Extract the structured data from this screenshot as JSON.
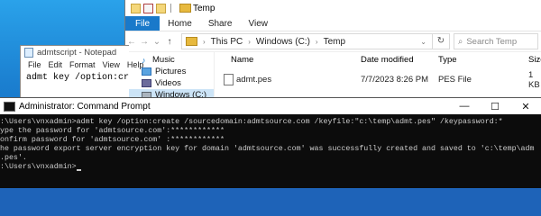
{
  "explorer": {
    "title": "Temp",
    "ribbon_tabs": [
      "File",
      "Home",
      "Share",
      "View"
    ],
    "breadcrumb": [
      "This PC",
      "Windows (C:)",
      "Temp"
    ],
    "search_placeholder": "Search Temp",
    "nav_items": [
      {
        "label": "Music",
        "icon": "music-icon"
      },
      {
        "label": "Pictures",
        "icon": "pictures-icon"
      },
      {
        "label": "Videos",
        "icon": "videos-icon"
      },
      {
        "label": "Windows (C:)",
        "icon": "drive-icon"
      }
    ],
    "columns": [
      "Name",
      "Date modified",
      "Type",
      "Size"
    ],
    "files": [
      {
        "name": "admt.pes",
        "date": "7/7/2023 8:26 PM",
        "type": "PES File",
        "size": "1 KB"
      }
    ]
  },
  "notepad": {
    "title": "admtscript - Notepad",
    "menu": [
      "File",
      "Edit",
      "Format",
      "View",
      "Help"
    ],
    "content": "admt key /option:create"
  },
  "cmd": {
    "title": "Administrator: Command Prompt",
    "controls": [
      "—",
      "☐",
      "✕"
    ],
    "lines": [
      ":\\Users\\vnxadmin>admt key /option:create /sourcedomain:admtsource.com /keyfile:\"c:\\temp\\admt.pes\" /keypassword:*",
      "ype the password for 'admtsource.com':************",
      "onfirm password for 'admtsource.com' :************",
      "he password export server encryption key for domain 'admtsource.com' was successfully created and saved to 'c:\\temp\\adm",
      ".pes'.",
      "",
      ":\\Users\\vnxadmin>"
    ]
  }
}
